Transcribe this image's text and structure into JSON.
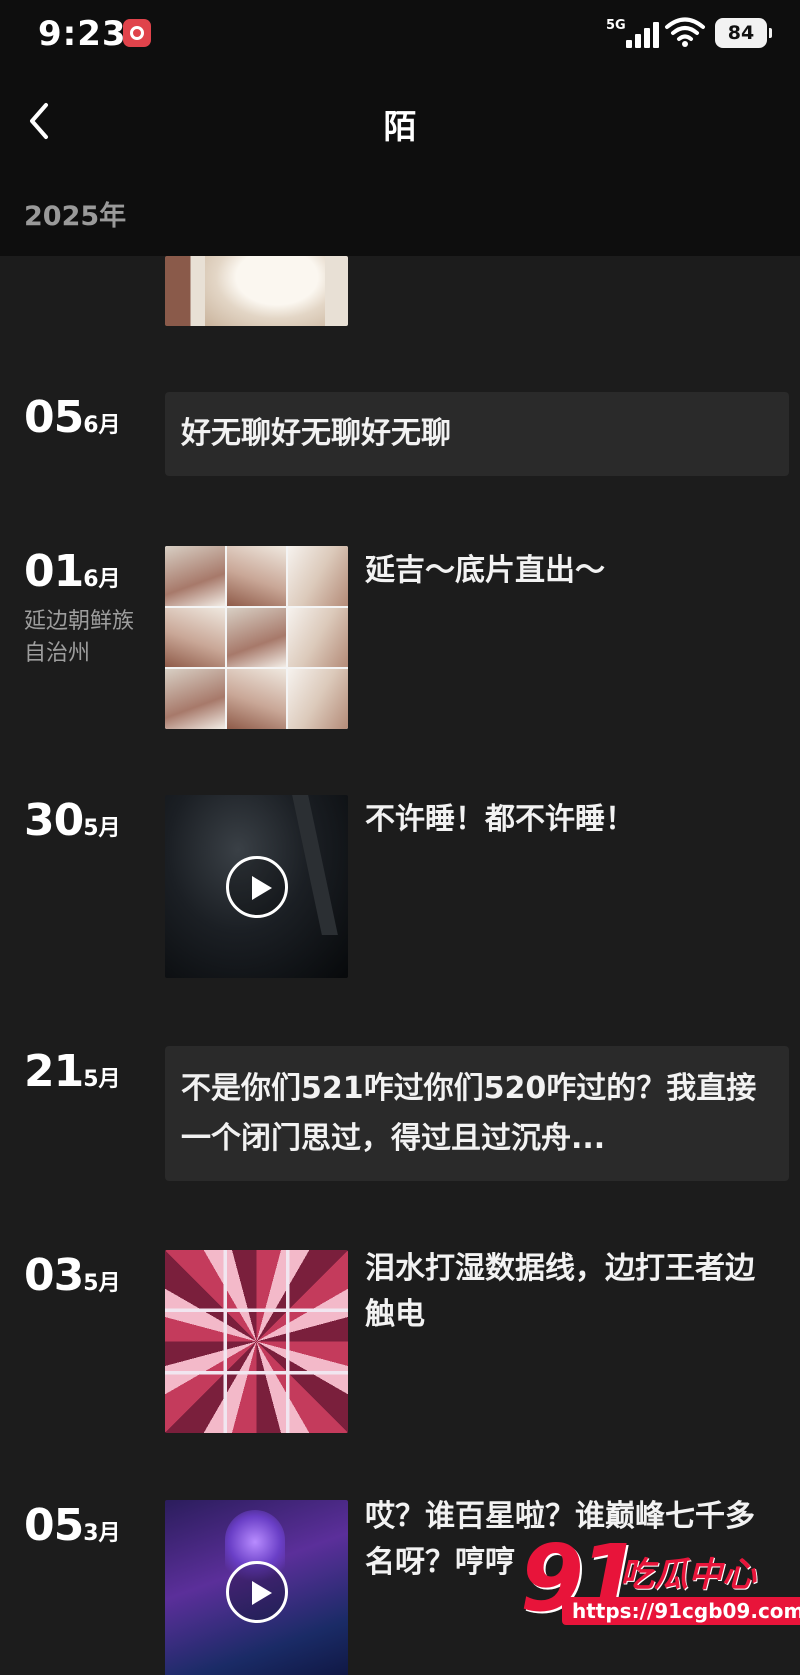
{
  "status_bar": {
    "time": "9:23",
    "network": "5G",
    "battery": "84"
  },
  "header": {
    "title": "陌",
    "year": "2025年"
  },
  "entries": [
    {
      "day": "05",
      "month": "6月",
      "type": "text",
      "text": "好无聊好无聊好无聊"
    },
    {
      "day": "01",
      "month": "6月",
      "location": "延边朝鲜族自治州",
      "type": "image-grid",
      "text": "延吉～底片直出～"
    },
    {
      "day": "30",
      "month": "5月",
      "type": "video",
      "text": "不许睡！都不许睡！"
    },
    {
      "day": "21",
      "month": "5月",
      "type": "text",
      "text": "不是你们521咋过你们520咋过的？我直接一个闭门思过，得过且过沉舟..."
    },
    {
      "day": "03",
      "month": "5月",
      "type": "image",
      "text": "泪水打湿数据线，边打王者边触电"
    },
    {
      "day": "05",
      "month": "3月",
      "type": "video",
      "text": "哎？谁百星啦？谁巅峰七千多名呀？哼哼"
    }
  ],
  "watermark": {
    "number": "91",
    "brand": "吃瓜中心",
    "url": "https://91cgb09.com"
  },
  "colors": {
    "background": "#1c1c1c",
    "header_bg": "#0e0e0e",
    "card_bg": "#2a2a2a",
    "watermark_red": "#e8143a"
  }
}
